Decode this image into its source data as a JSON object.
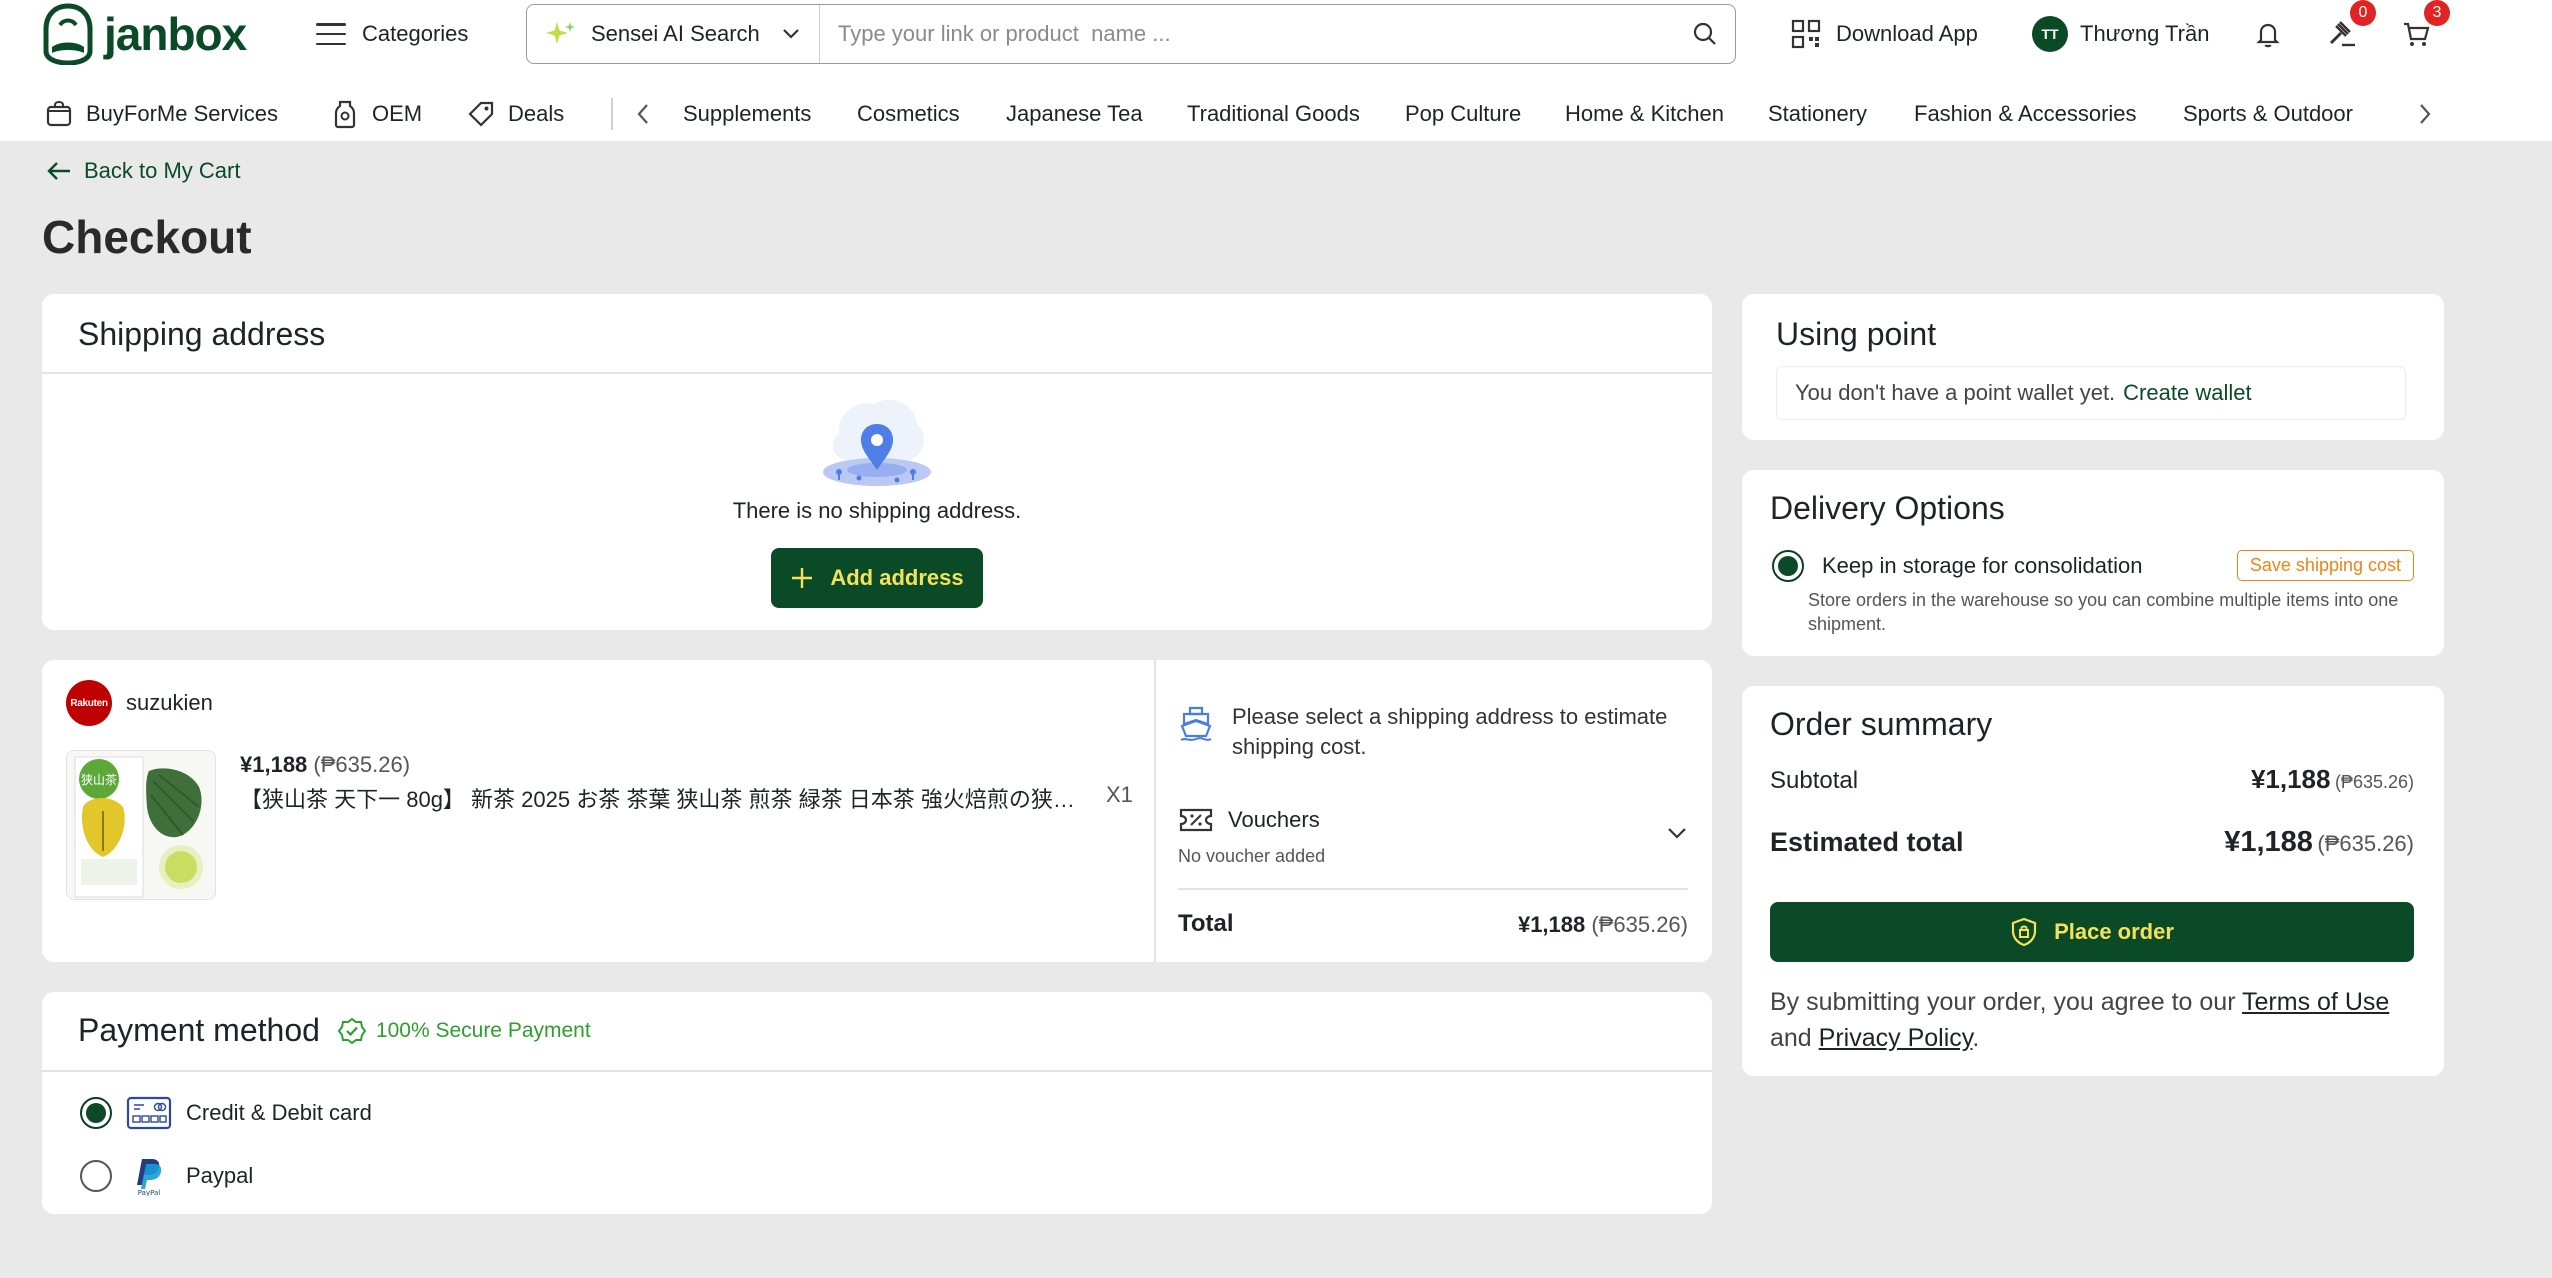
{
  "header": {
    "logo_text": "janbox",
    "categories_label": "Categories",
    "ai_search_label": "Sensei AI Search",
    "search_placeholder": "Type your link or product  name ...",
    "download_app_label": "Download App",
    "user_initials": "TT",
    "user_name": "Thương Trần",
    "auction_badge": "0",
    "cart_badge": "3"
  },
  "catbar": {
    "fixed": [
      {
        "label": "BuyForMe Services",
        "icon": "bag-icon"
      },
      {
        "label": "OEM",
        "icon": "bottle-icon"
      },
      {
        "label": "Deals",
        "icon": "tag-icon"
      }
    ],
    "links": [
      "Supplements",
      "Cosmetics",
      "Japanese Tea",
      "Traditional Goods",
      "Pop Culture",
      "Home & Kitchen",
      "Stationery",
      "Fashion & Accessories",
      "Sports & Outdoor"
    ]
  },
  "page": {
    "back_label": "Back to My Cart",
    "title": "Checkout"
  },
  "shipping": {
    "title": "Shipping address",
    "empty_text": "There is no shipping address.",
    "add_button": "Add address"
  },
  "item": {
    "shop_logo_text": "Rakuten",
    "shop_name": "suzukien",
    "price": "¥1,188",
    "price_alt": "(₱635.26)",
    "name": "【狭山茶 天下一 80g】 新茶 2025 お茶 茶葉 狭山茶 煎茶 緑茶 日本茶 強火焙煎の狭山茶 ...",
    "qty": "X1",
    "package_label": "狭山茶",
    "ship_estimate": "Please select a shipping address to estimate shipping cost.",
    "vouchers_title": "Vouchers",
    "vouchers_sub": "No voucher added",
    "total_label": "Total",
    "total_value": "¥1,188",
    "total_alt": "(₱635.26)"
  },
  "payment": {
    "title": "Payment method",
    "secure_label": "100% Secure Payment",
    "options": [
      {
        "label": "Credit & Debit card",
        "selected": true
      },
      {
        "label": "Paypal",
        "selected": false
      }
    ]
  },
  "points": {
    "title": "Using point",
    "no_wallet_text": "You don't have a point wallet yet.",
    "create_wallet": "Create wallet"
  },
  "delivery": {
    "title": "Delivery Options",
    "option_label": "Keep in storage for consolidation",
    "tag": "Save shipping cost",
    "description": "Store orders in the warehouse so you can combine multiple items into one shipment."
  },
  "summary": {
    "title": "Order summary",
    "subtotal_label": "Subtotal",
    "subtotal_value": "¥1,188",
    "subtotal_alt": "(₱635.26)",
    "estimated_label": "Estimated total",
    "estimated_value": "¥1,188",
    "estimated_alt": "(₱635.26)",
    "place_order": "Place order",
    "terms_prefix": "By submitting your order, you agree to our",
    "terms_link": "Terms of Use",
    "terms_and": "and",
    "privacy_link": "Privacy Policy",
    "terms_end": "."
  },
  "colors": {
    "brand_green": "#0b4a27",
    "button_text_yellow": "#f4e25a",
    "badge_red": "#e02424",
    "tag_orange": "#e8861a",
    "secure_green": "#2f9e2f"
  }
}
